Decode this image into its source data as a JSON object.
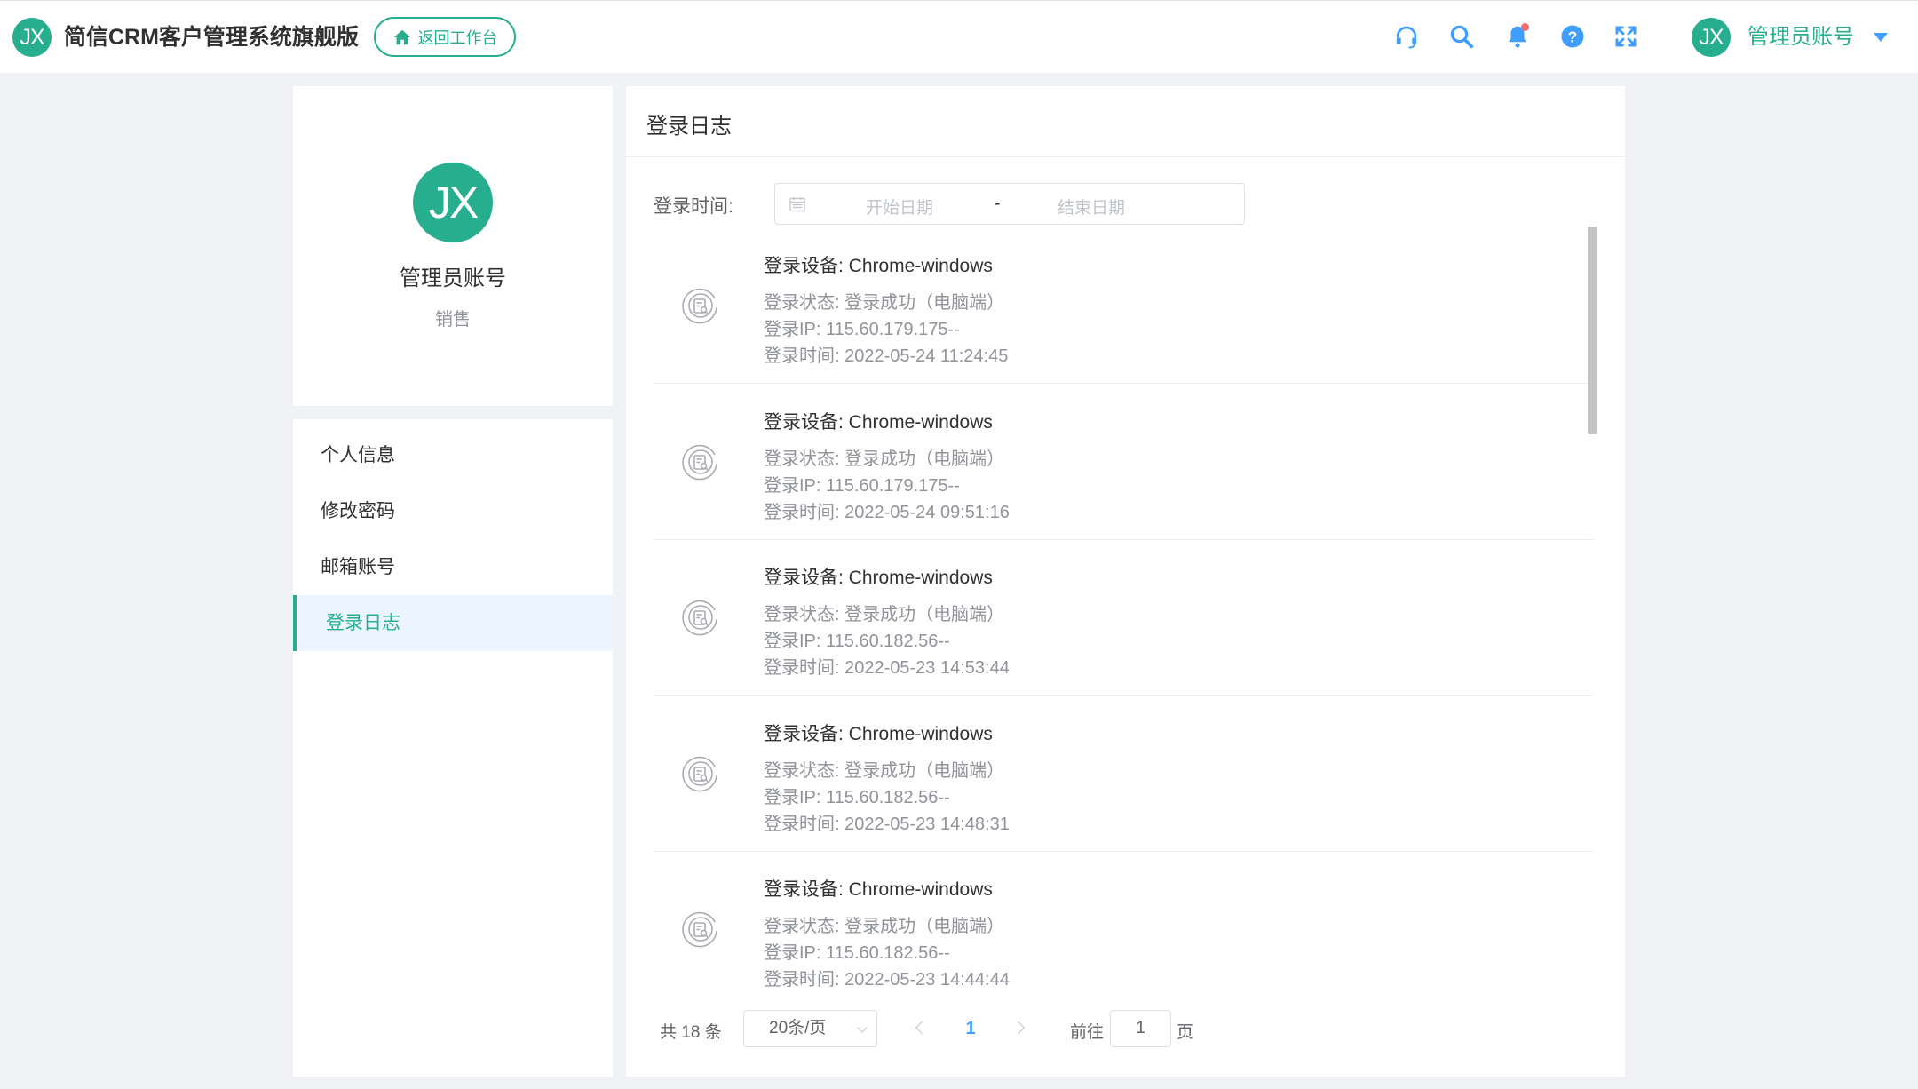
{
  "app": {
    "logo_text": "JX",
    "title": "简信CRM客户管理系统旗舰版",
    "back_button": "返回工作台"
  },
  "topbar": {
    "icons": [
      "headset-icon",
      "search-icon",
      "bell-icon",
      "help-icon",
      "fullscreen-icon"
    ],
    "notification_dot_color": "#f56c6c",
    "user": {
      "avatar_text": "JX",
      "name": "管理员账号"
    }
  },
  "profile": {
    "avatar_text": "JX",
    "name": "管理员账号",
    "role": "销售"
  },
  "menu": {
    "items": [
      {
        "label": "个人信息",
        "active": false
      },
      {
        "label": "修改密码",
        "active": false
      },
      {
        "label": "邮箱账号",
        "active": false
      },
      {
        "label": "登录日志",
        "active": true
      }
    ]
  },
  "main": {
    "title": "登录日志",
    "filter": {
      "label": "登录时间:",
      "start_placeholder": "开始日期",
      "separator": "-",
      "end_placeholder": "结束日期"
    },
    "logs": [
      {
        "device": "登录设备:  Chrome-windows",
        "status": "登录状态:  登录成功（电脑端）",
        "ip": "登录IP:  115.60.179.175--",
        "time": "登录时间:  2022-05-24 11:24:45"
      },
      {
        "device": "登录设备:  Chrome-windows",
        "status": "登录状态:  登录成功（电脑端）",
        "ip": "登录IP:  115.60.179.175--",
        "time": "登录时间:  2022-05-24 09:51:16"
      },
      {
        "device": "登录设备:  Chrome-windows",
        "status": "登录状态:  登录成功（电脑端）",
        "ip": "登录IP:  115.60.182.56--",
        "time": "登录时间:  2022-05-23 14:53:44"
      },
      {
        "device": "登录设备:  Chrome-windows",
        "status": "登录状态:  登录成功（电脑端）",
        "ip": "登录IP:  115.60.182.56--",
        "time": "登录时间:  2022-05-23 14:48:31"
      },
      {
        "device": "登录设备:  Chrome-windows",
        "status": "登录状态:  登录成功（电脑端）",
        "ip": "登录IP:  115.60.182.56--",
        "time": "登录时间:  2022-05-23 14:44:44"
      }
    ],
    "pagination": {
      "total": "共 18 条",
      "page_size": "20条/页",
      "current_page": "1",
      "goto_label": "前往",
      "goto_value": "1",
      "goto_suffix": "页"
    }
  },
  "colors": {
    "brand": "#26ae8e",
    "link": "#409eff",
    "active_menu_bg": "#ecf5ff",
    "background": "#f0f2f5"
  }
}
